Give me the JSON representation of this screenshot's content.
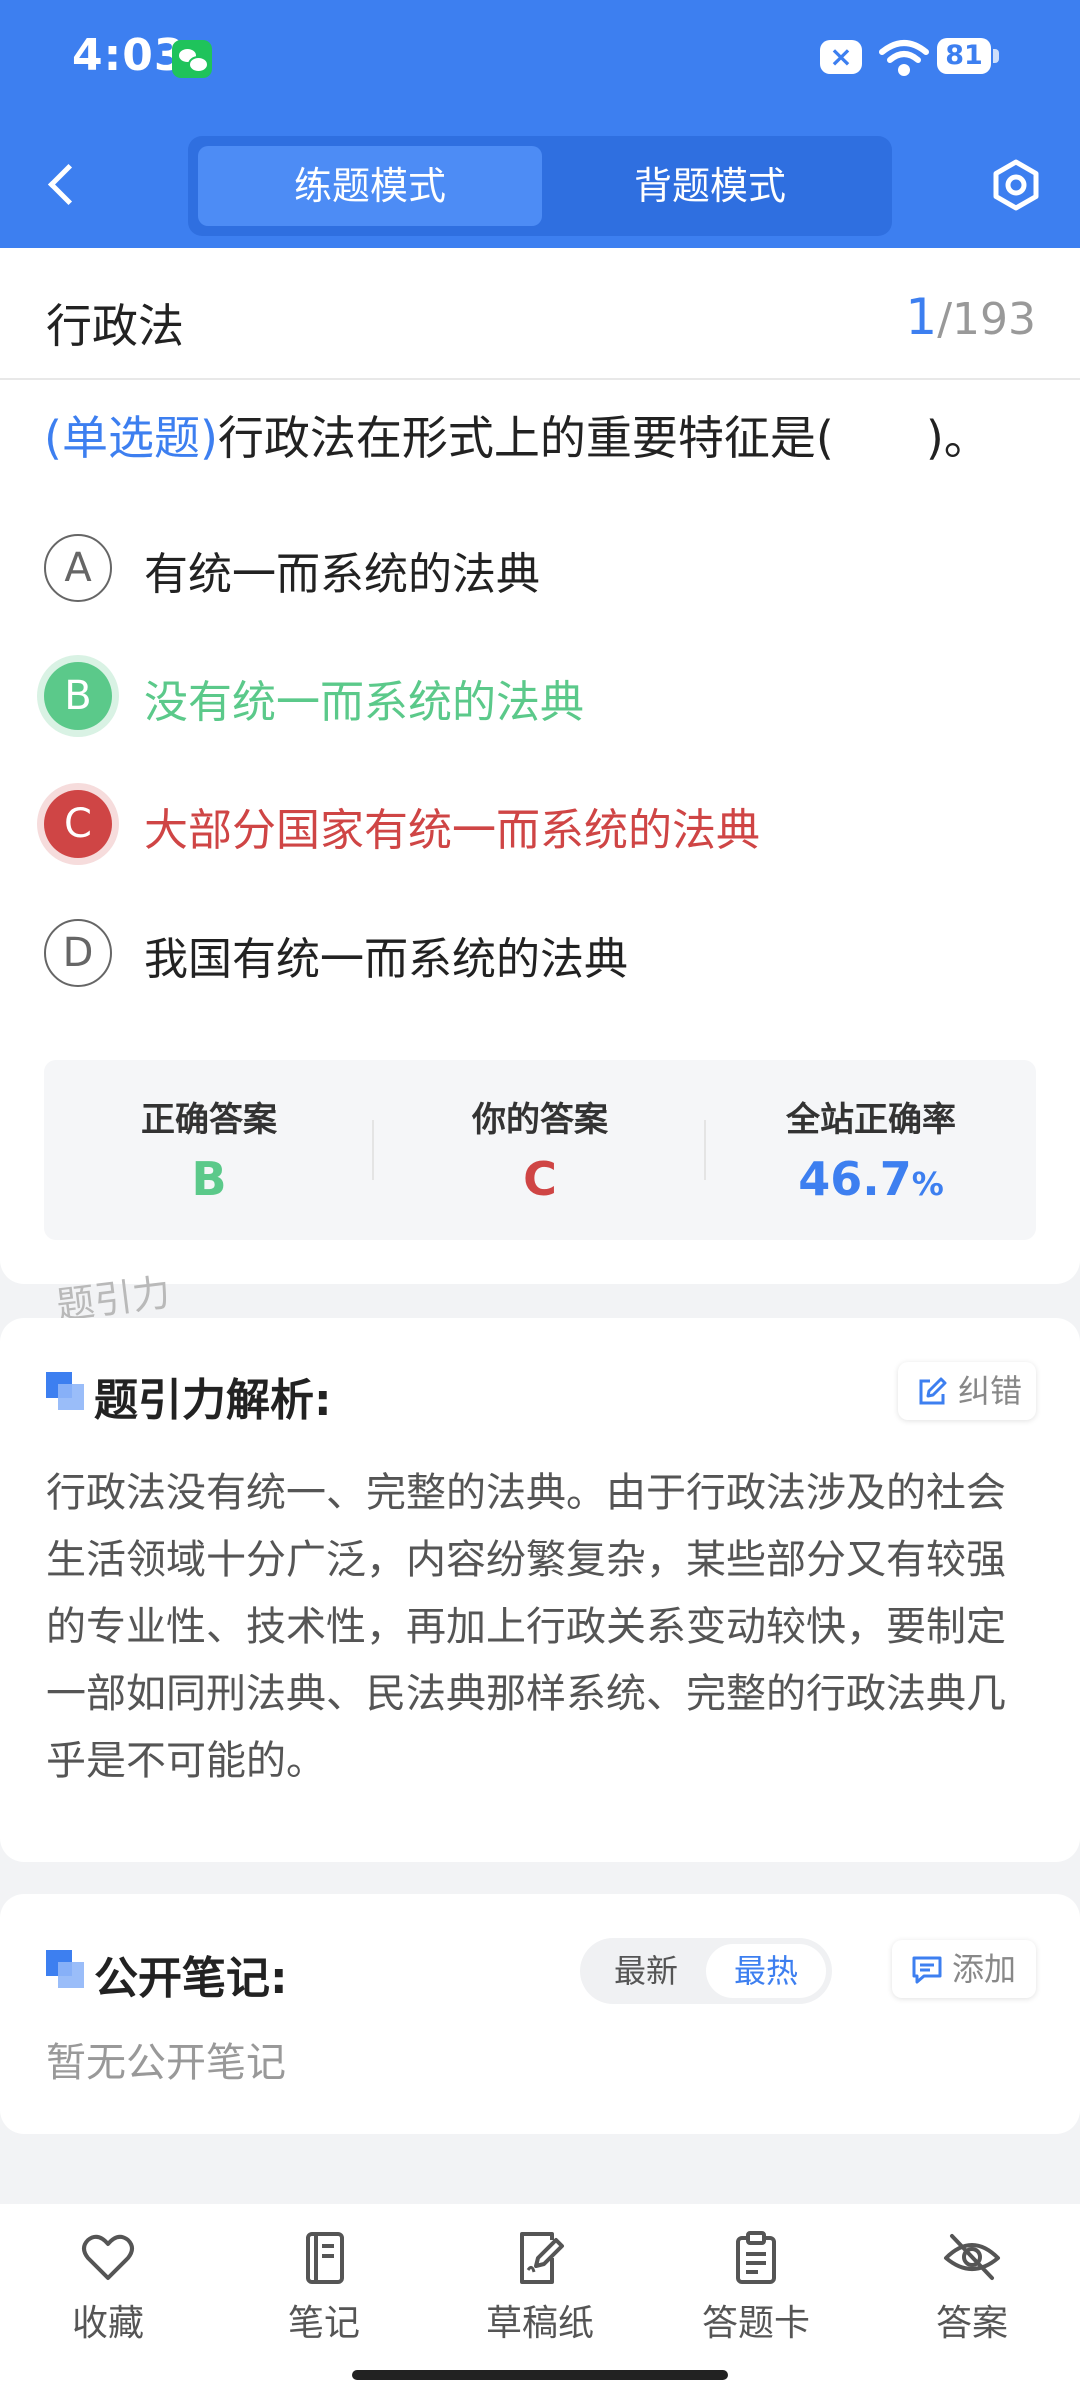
{
  "status_bar": {
    "time": "4:03",
    "battery": "81",
    "sim_label": "×"
  },
  "header": {
    "modes": [
      "练题模式",
      "背题模式"
    ],
    "active_mode": "练题模式"
  },
  "question_meta": {
    "subject": "行政法",
    "current": "1",
    "total": "/193"
  },
  "question": {
    "type_label": "(单选题)",
    "text": "行政法在形式上的重要特征是(　　)。",
    "options": [
      {
        "letter": "A",
        "text": "有统一而系统的法典",
        "state": "normal"
      },
      {
        "letter": "B",
        "text": "没有统一而系统的法典",
        "state": "correct"
      },
      {
        "letter": "C",
        "text": "大部分国家有统一而系统的法典",
        "state": "wrong"
      },
      {
        "letter": "D",
        "text": "我国有统一而系统的法典",
        "state": "normal"
      }
    ]
  },
  "answer_panel": {
    "correct_label": "正确答案",
    "correct_value": "B",
    "your_label": "你的答案",
    "your_value": "C",
    "rate_label": "全站正确率",
    "rate_value": "46.7",
    "rate_unit": "%"
  },
  "watermark": "题引力",
  "analysis": {
    "title": "题引力解析:",
    "report_label": "纠错",
    "text": "行政法没有统一、完整的法典。由于行政法涉及的社会生活领域十分广泛，内容纷繁复杂，某些部分又有较强的专业性、技术性，再加上行政关系变动较快，要制定一部如同刑法典、民法典那样系统、完整的行政法典几乎是不可能的。"
  },
  "notes": {
    "title": "公开笔记:",
    "sort_new": "最新",
    "sort_hot": "最热",
    "active_sort": "最热",
    "add_label": "添加",
    "empty_text": "暂无公开笔记"
  },
  "toolbar": [
    {
      "label": "收藏",
      "icon": "heart-icon"
    },
    {
      "label": "笔记",
      "icon": "notebook-icon"
    },
    {
      "label": "草稿纸",
      "icon": "draft-icon"
    },
    {
      "label": "答题卡",
      "icon": "clipboard-icon"
    },
    {
      "label": "答案",
      "icon": "eye-off-icon"
    }
  ],
  "colors": {
    "primary": "#3d7ff0",
    "correct": "#5bc98a",
    "wrong": "#cf4545",
    "background": "#f2f3f5"
  }
}
